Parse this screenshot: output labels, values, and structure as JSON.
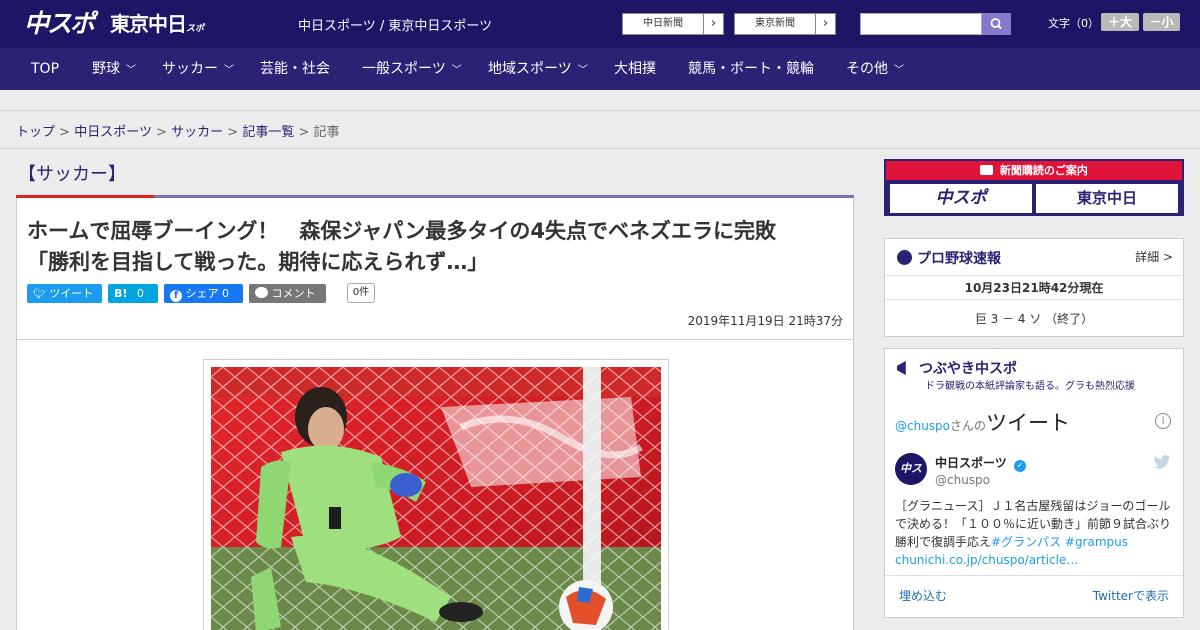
{
  "header": {
    "logo_primary": "中スポ",
    "logo_secondary": "東京中日",
    "logo_secondary_sub": "スポーツ",
    "site_links": "中日スポーツ / 東京中日スポーツ",
    "link_buttons": [
      {
        "label": "中日新聞"
      },
      {
        "label": "東京新聞"
      }
    ],
    "search": {
      "placeholder": ""
    },
    "font_size_label": "文字（0）",
    "font_plus": "＋大",
    "font_minus": "－小"
  },
  "nav": [
    {
      "label": "TOP",
      "has_menu": false
    },
    {
      "label": "野球",
      "has_menu": true
    },
    {
      "label": "サッカー",
      "has_menu": true
    },
    {
      "label": "芸能・社会",
      "has_menu": false
    },
    {
      "label": "一般スポーツ",
      "has_menu": true
    },
    {
      "label": "地域スポーツ",
      "has_menu": true
    },
    {
      "label": "大相撲",
      "has_menu": false
    },
    {
      "label": "競馬・ボート・競輪",
      "has_menu": false
    },
    {
      "label": "その他",
      "has_menu": true
    }
  ],
  "breadcrumb": [
    {
      "label": "トップ",
      "link": true
    },
    {
      "label": "中日スポーツ",
      "link": true
    },
    {
      "label": "サッカー",
      "link": true
    },
    {
      "label": "記事一覧",
      "link": true
    },
    {
      "label": "記事",
      "link": false
    }
  ],
  "breadcrumb_sep": ">",
  "category_title": "【サッカー】",
  "article": {
    "headline_line1": "ホームで屈辱ブーイング！　森保ジャパン最多タイの4失点でベネズエラに完敗",
    "headline_line2": "「勝利を目指して戦った。期待に応えられず…」",
    "share": {
      "tweet": "ツイート",
      "hatena_icon": "B!",
      "hatena_count": "0",
      "facebook": "シェア 0",
      "comment": "コメント",
      "comment_count": "0件"
    },
    "date": "2019年11月19日 21時37分"
  },
  "sidebar": {
    "ad": {
      "title": "新聞購読のご案内",
      "logo1": "中スポ",
      "logo2": "東京中日"
    },
    "baseball": {
      "title": "プロ野球速報",
      "more": "詳細 >",
      "time": "10月23日21時42分現在",
      "score": "巨 3 － 4 ソ （終了）"
    },
    "tweets": {
      "title": "つぶやき中スポ",
      "subtitle": "ドラ観戦の本紙評論家も語る。グラも熱烈応援",
      "head_user": "@chuspo",
      "head_suffix": "さんの",
      "head_big": "ツイート",
      "author_name": "中日スポーツ",
      "author_handle": "@chuspo",
      "text_plain": "［グラニュース］Ｊ１名古屋残留はジョーのゴールで決める！「１００％に近い動き」前節９試合ぶり勝利で復調手応え",
      "text_tags": "#グランパス #grampus",
      "text_link": "chunichi.co.jp/chuspo/article…",
      "embed": "埋め込む",
      "view_on_twitter": "Twitterで表示"
    }
  },
  "colors": {
    "header_bg": "#1d1666",
    "nav_bg": "#2b2276",
    "accent_red": "#dd2222",
    "twitter_blue": "#1d9bf0",
    "facebook_blue": "#1877f2",
    "hatena_blue": "#00a4de"
  }
}
